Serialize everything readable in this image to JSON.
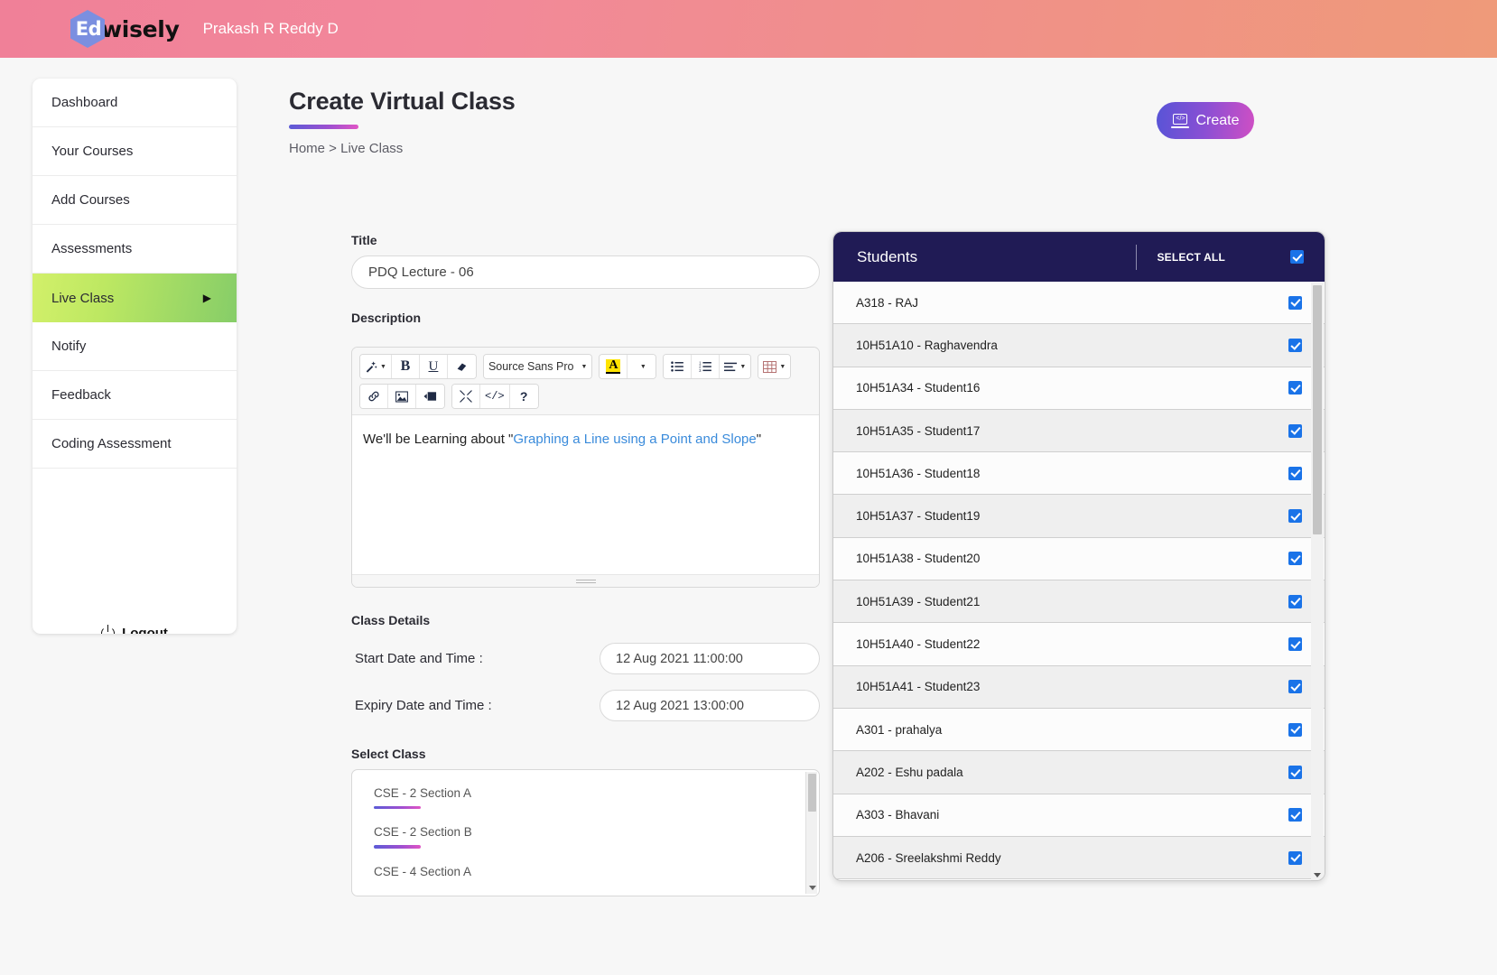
{
  "topbar": {
    "logo_mark": "Ed",
    "logo_word": "wisely",
    "user_name": "Prakash R Reddy D"
  },
  "sidebar": {
    "items": [
      {
        "label": "Dashboard",
        "active": false
      },
      {
        "label": "Your Courses",
        "active": false
      },
      {
        "label": "Add Courses",
        "active": false
      },
      {
        "label": "Assessments",
        "active": false
      },
      {
        "label": "Live Class",
        "active": true
      },
      {
        "label": "Notify",
        "active": false
      },
      {
        "label": "Feedback",
        "active": false
      },
      {
        "label": "Coding Assessment",
        "active": false
      }
    ],
    "active_arrow": "▶",
    "logout_label": "Logout"
  },
  "header": {
    "title": "Create Virtual Class",
    "breadcrumb": "Home > Live Class",
    "create_button": "Create",
    "create_icon": "laptop-code-icon"
  },
  "form": {
    "title_label": "Title",
    "title_value": "PDQ Lecture - 06",
    "title_placeholder": "Title",
    "description_label": "Description",
    "description_text_before": "We'll be Learning about \"",
    "description_link": "Graphing a Line using a Point and Slope",
    "description_text_after": "\"",
    "toolbar": {
      "row1": [
        {
          "name": "magic-wand-icon",
          "glyph": "✨",
          "caret": true
        },
        {
          "name": "bold-icon",
          "glyph": "B",
          "caret": false
        },
        {
          "name": "underline-icon",
          "glyph": "U",
          "caret": false
        },
        {
          "name": "eraser-icon",
          "glyph": "◨",
          "caret": false
        }
      ],
      "font_family": "Source Sans Pro",
      "highlight": {
        "name": "text-highlight-icon",
        "glyph": "A"
      },
      "list_buttons": [
        {
          "name": "unordered-list-icon",
          "glyph": "☰"
        },
        {
          "name": "ordered-list-icon",
          "glyph": "☰"
        },
        {
          "name": "align-icon",
          "glyph": "≡",
          "caret": true
        },
        {
          "name": "table-icon",
          "glyph": "▦",
          "caret": true
        }
      ],
      "row2": [
        {
          "name": "link-icon",
          "glyph": "🔗"
        },
        {
          "name": "image-icon",
          "glyph": "🌄"
        },
        {
          "name": "video-icon",
          "glyph": "▶■"
        },
        {
          "name": "fullscreen-icon",
          "glyph": "⤨"
        },
        {
          "name": "source-code-icon",
          "glyph": "</>"
        },
        {
          "name": "help-icon",
          "glyph": "?"
        }
      ]
    },
    "class_details_label": "Class Details",
    "start_label": "Start Date and Time :",
    "start_value": "12 Aug 2021 11:00:00",
    "expiry_label": "Expiry Date and Time :",
    "expiry_value": "12 Aug 2021 13:00:00",
    "select_class_label": "Select Class",
    "classes": [
      "CSE - 2 Section A",
      "CSE - 2 Section B",
      "CSE - 4 Section A"
    ]
  },
  "students_panel": {
    "title": "Students",
    "select_all_label": "SELECT ALL",
    "select_all_checked": true,
    "rows": [
      {
        "name": "A318 - RAJ",
        "checked": true
      },
      {
        "name": "10H51A10 - Raghavendra",
        "checked": true
      },
      {
        "name": "10H51A34 - Student16",
        "checked": true
      },
      {
        "name": "10H51A35 - Student17",
        "checked": true
      },
      {
        "name": "10H51A36 - Student18",
        "checked": true
      },
      {
        "name": "10H51A37 - Student19",
        "checked": true
      },
      {
        "name": "10H51A38 - Student20",
        "checked": true
      },
      {
        "name": "10H51A39 - Student21",
        "checked": true
      },
      {
        "name": "10H51A40 - Student22",
        "checked": true
      },
      {
        "name": "10H51A41 - Student23",
        "checked": true
      },
      {
        "name": "A301 - prahalya",
        "checked": true
      },
      {
        "name": "A202 - Eshu padala",
        "checked": true
      },
      {
        "name": "A303 - Bhavani",
        "checked": true
      },
      {
        "name": "A206 - Sreelakshmi Reddy",
        "checked": true
      }
    ]
  },
  "colors": {
    "header_gradient_start": "#f08098",
    "header_gradient_end": "#ef9a79",
    "sidebar_active_start": "#d2f06a",
    "sidebar_active_end": "#86cd68",
    "accent_gradient_start": "#5b5bd6",
    "accent_gradient_end": "#e055c5",
    "panel_header": "#201b55",
    "checkbox_blue": "#1a73e8",
    "link_blue": "#3a8bdb",
    "highlight_yellow": "#ffe400"
  }
}
